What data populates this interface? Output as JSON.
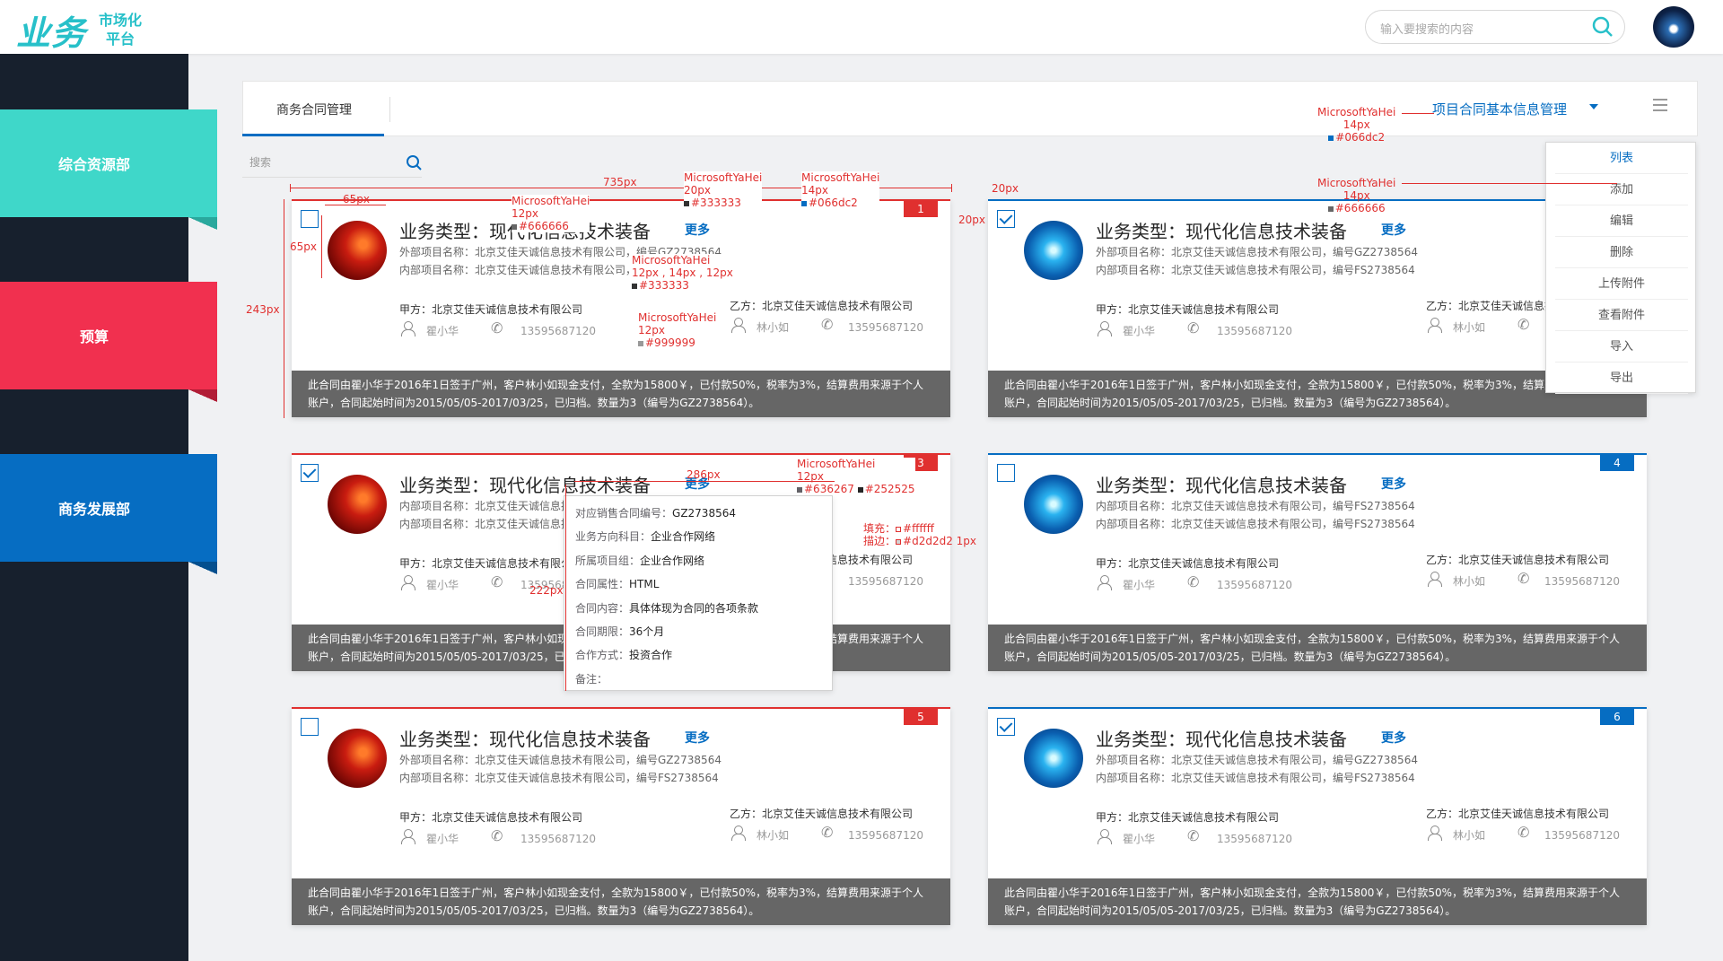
{
  "header": {
    "logo": "业务",
    "logo_sub1": "市场化",
    "logo_sub2": "平台",
    "search_placeholder": "输入要搜索的内容"
  },
  "sidebar": {
    "items": [
      {
        "label": "综合资源部",
        "color": "#3fd7c9",
        "fold": "#2aa89d"
      },
      {
        "label": "预算",
        "color": "#f1304f",
        "fold": "#b11d36"
      },
      {
        "label": "商务发展部",
        "color": "#066dc2",
        "fold": "#044f8e"
      }
    ]
  },
  "main": {
    "tab": "商务合同管理",
    "dropdown_label": "项目合同基本信息管理",
    "search_placeholder": "搜索",
    "menu": [
      "列表",
      "添加",
      "编辑",
      "删除",
      "上传附件",
      "查看附件",
      "导入",
      "导出"
    ]
  },
  "card": {
    "title": "业务类型：现代化信息技术装备",
    "more": "更多",
    "party_a": "甲方：北京艾佳天诚信息技术有限公司",
    "party_b": "乙方：北京艾佳天诚信息技术有限公司",
    "contact_a": "瞿小华",
    "contact_b": "林小如",
    "phone": "13595687120",
    "footer": "此合同由瞿小华于2016年1日签于广州，客户林小如现金支付，全款为15800￥，已付款50%，税率为3%，结算费用来源于个人账户，合同起始时间为2015/05/05-2017/03/25，已归档。数量为3（编号为GZ2738564）。"
  },
  "cards": [
    {
      "num": "1",
      "line1": "外部项目名称：北京艾佳天诚信息技术有限公司，编号GZ2738564",
      "line2": "内部项目名称：北京艾佳天诚信息技术有限公司，编号FS2738564"
    },
    {
      "num": "",
      "line1": "外部项目名称：北京艾佳天诚信息技术有限公司，编号GZ2738564",
      "line2": "内部项目名称：北京艾佳天诚信息技术有限公司，编号FS2738564"
    },
    {
      "num": "3",
      "line1": "内部项目名称：北京艾佳天诚信息技术有限公司",
      "line2": "内部项目名称：北京艾佳天诚信息技术有限公司"
    },
    {
      "num": "4",
      "line1": "内部项目名称：北京艾佳天诚信息技术有限公司，编号FS2738564",
      "line2": "内部项目名称：北京艾佳天诚信息技术有限公司，编号FS2738564"
    },
    {
      "num": "5",
      "line1": "外部项目名称：北京艾佳天诚信息技术有限公司，编号GZ2738564",
      "line2": "内部项目名称：北京艾佳天诚信息技术有限公司，编号FS2738564"
    },
    {
      "num": "6",
      "line1": "外部项目名称：北京艾佳天诚信息技术有限公司，编号GZ2738564",
      "line2": "内部项目名称：北京艾佳天诚信息技术有限公司，编号FS2738564"
    }
  ],
  "popup": {
    "rows": [
      {
        "k": "对应销售合同编号：",
        "v": "GZ2738564"
      },
      {
        "k": "业务方向科目：",
        "v": "企业合作网络"
      },
      {
        "k": "所属项目组：",
        "v": "企业合作网络"
      },
      {
        "k": "合同属性：",
        "v": "HTML"
      },
      {
        "k": "合同内容：",
        "v": "具体体现为合同的各项条款"
      },
      {
        "k": "合同期限：",
        "v": "36个月"
      },
      {
        "k": "合作方式：",
        "v": "投资合作"
      },
      {
        "k": "备注：",
        "v": ""
      }
    ]
  },
  "annotations": {
    "a_735": "735px",
    "a_65w": "65px",
    "a_65h": "65px",
    "a_243": "243px",
    "a_20w": "20px",
    "a_20h": "20px",
    "a_286": "286px",
    "a_222": "222px",
    "font_title": "MicrosoftYaHei",
    "font_title2": "20px",
    "c333": "#333333",
    "font_more": "MicrosoftYaHei",
    "font_more2": "14px",
    "c066": "#066dc2",
    "font_num": "MicrosoftYaHei",
    "font_num2": "12px",
    "c666": "#666666",
    "font_info": "MicrosoftYaHei",
    "font_info2": "12px , 14px , 12px",
    "c333b": "#333333",
    "font_gray": "MicrosoftYaHei",
    "font_gray2": "12px",
    "c999": "#999999",
    "font_dd": "MicrosoftYaHei",
    "font_dd2": "14px",
    "c066b": "#066dc2",
    "font_menu": "MicrosoftYaHei",
    "font_menu2": "14px",
    "c666b": "#666666",
    "font_pop": "MicrosoftYaHei",
    "font_pop2": "12px",
    "c636": "#636267",
    "c252": "#252525",
    "fill": "填充：",
    "fill_v": "#ffffff",
    "stroke": "描边：",
    "stroke_v": "#d2d2d2 1px"
  }
}
